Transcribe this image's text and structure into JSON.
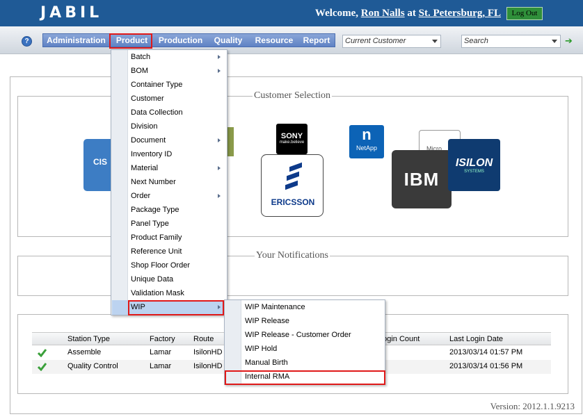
{
  "header": {
    "logo": "JABIL",
    "welcome": "Welcome,",
    "user": "Ron Nalls",
    "at": "at",
    "location": "St. Petersburg, FL",
    "logout": "Log Out"
  },
  "nav": {
    "help": "?",
    "menu": [
      "Administration",
      "Product",
      "Production",
      "Quality",
      "Resource",
      "Report"
    ],
    "customer_select": "Current Customer",
    "search": "Search",
    "go_icon": "green-arrow-icon"
  },
  "customer_panel": {
    "legend": "Customer Selection",
    "logos": {
      "cisco": "CIS",
      "sony": "SONY",
      "sony_tag": "make.believe",
      "ericsson": "ERICSSON",
      "netapp": "NetApp",
      "microsoft": "Micro",
      "ibm": "IBM",
      "isilon": "ISILON",
      "isilon_tag": "SYSTEMS"
    }
  },
  "notifications": {
    "legend": "Your Notifications"
  },
  "stations": {
    "headers": [
      "Station Type",
      "Factory",
      "Route",
      "Login Count",
      "Last Login Date"
    ],
    "rows": [
      {
        "type": "Assemble",
        "factory": "Lamar",
        "route": "IsilonHD",
        "last_login": "2013/03/14 01:57 PM"
      },
      {
        "type": "Quality Control",
        "factory": "Lamar",
        "route": "IsilonHD",
        "last_login": "2013/03/14 01:56 PM"
      }
    ]
  },
  "product_menu": [
    {
      "label": "Batch",
      "sub": true
    },
    {
      "label": "BOM",
      "sub": true
    },
    {
      "label": "Container Type",
      "sub": false
    },
    {
      "label": "Customer",
      "sub": false
    },
    {
      "label": "Data Collection",
      "sub": false
    },
    {
      "label": "Division",
      "sub": false
    },
    {
      "label": "Document",
      "sub": true
    },
    {
      "label": "Inventory ID",
      "sub": false
    },
    {
      "label": "Material",
      "sub": true
    },
    {
      "label": "Next Number",
      "sub": false
    },
    {
      "label": "Order",
      "sub": true
    },
    {
      "label": "Package Type",
      "sub": false
    },
    {
      "label": "Panel Type",
      "sub": false
    },
    {
      "label": "Product Family",
      "sub": false
    },
    {
      "label": "Reference Unit",
      "sub": false
    },
    {
      "label": "Shop Floor Order",
      "sub": false
    },
    {
      "label": "Unique Data",
      "sub": false
    },
    {
      "label": "Validation Mask",
      "sub": false
    },
    {
      "label": "WIP",
      "sub": true
    }
  ],
  "wip_menu": [
    "WIP Maintenance",
    "WIP Release",
    "WIP Release - Customer Order",
    "WIP Hold",
    "Manual Birth",
    "Internal RMA"
  ],
  "footer": {
    "version": "Version: 2012.1.1.9213"
  },
  "colors": {
    "header_bg": "#1f5a96",
    "menu_bg": "#6b8fcd",
    "highlight": "#e01818",
    "selected_row": "#bcd3f0"
  }
}
